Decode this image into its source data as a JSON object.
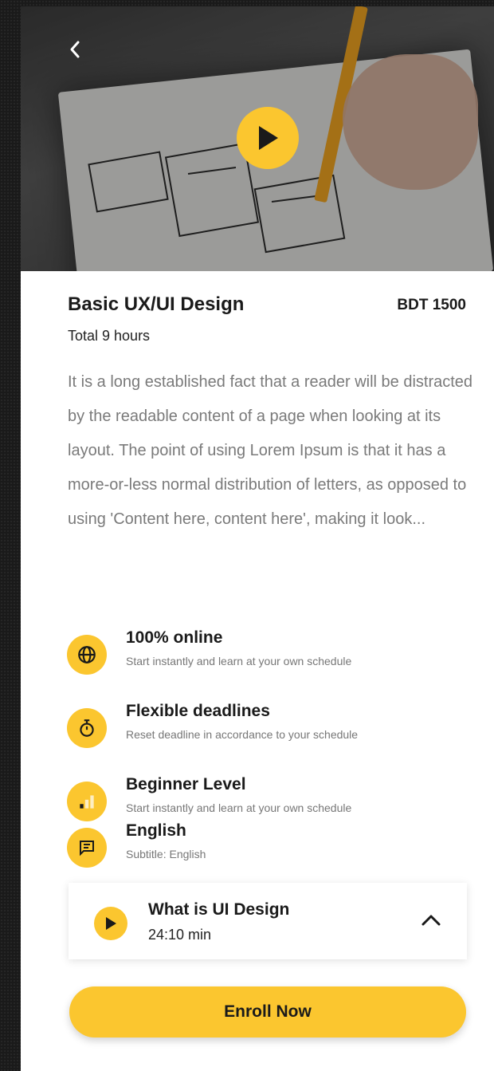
{
  "course": {
    "title": "Basic UX/UI Design",
    "price": "BDT 1500",
    "total": "Total 9 hours",
    "description": "It is a long established fact that a reader will be distracted by the readable content of a page when looking at its layout. The point of using Lorem Ipsum is that it has a more-or-less normal distribution of letters, as opposed to using 'Content here, content here', making it look..."
  },
  "features": [
    {
      "title": "100% online",
      "subtitle": "Start instantly and learn at your own schedule",
      "icon": "globe-icon"
    },
    {
      "title": "Flexible deadlines",
      "subtitle": "Reset deadline in accordance to your schedule",
      "icon": "stopwatch-icon"
    },
    {
      "title": "Beginner Level",
      "subtitle": "Start instantly and learn at your own schedule",
      "icon": "signal-bars-icon"
    },
    {
      "title": "English",
      "subtitle": "Subtitle: English",
      "icon": "subtitle-icon"
    }
  ],
  "lesson": {
    "title": "What is UI Design",
    "duration": "24:10 min"
  },
  "enroll_label": "Enroll Now",
  "colors": {
    "accent": "#fbc62f",
    "text": "#1a1a1a",
    "muted": "#7a7a7a"
  }
}
